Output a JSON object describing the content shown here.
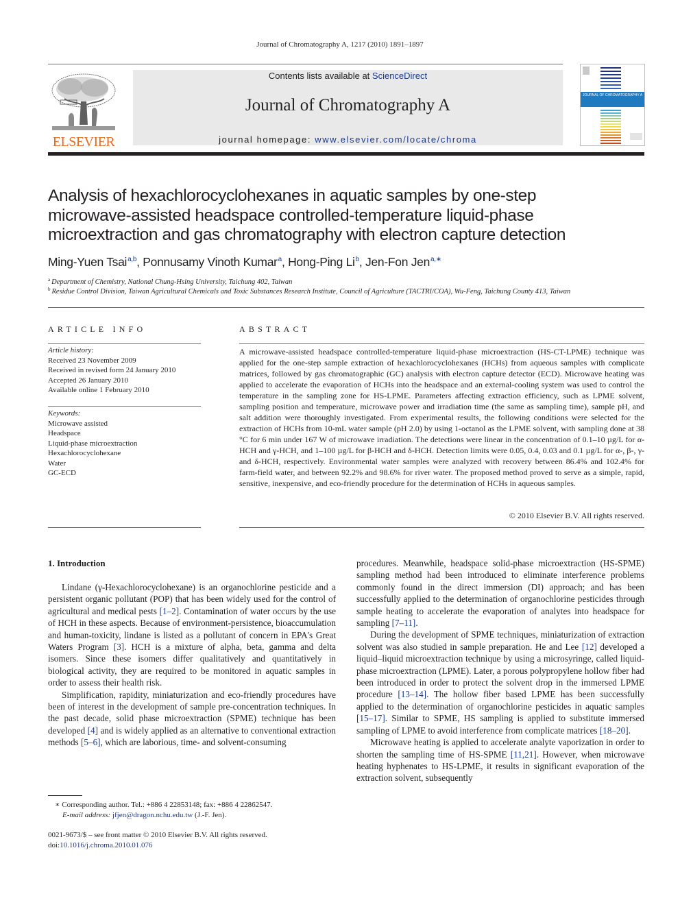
{
  "running_head": "Journal of Chromatography A, 1217 (2010) 1891–1897",
  "masthead": {
    "publisher_logo": "ELSEVIER",
    "contents_prefix": "Contents lists available at ",
    "contents_link": "ScienceDirect",
    "journal_name": "Journal of Chromatography A",
    "homepage_prefix": "journal homepage: ",
    "homepage_link": "www.elsevier.com/locate/chroma",
    "cover_title": "JOURNAL OF CHROMATOGRAPHY A",
    "colors": {
      "elsevier_orange": "#e86c1f",
      "link_blue": "#1a3a8f",
      "band_grey": "#e9e9e9",
      "cover_blue": "#1f7ac0"
    }
  },
  "article": {
    "title_lines": [
      "Analysis of hexachlorocyclohexanes in aquatic samples by one-step",
      "microwave-assisted headspace controlled-temperature liquid-phase",
      "microextraction and gas chromatography with electron capture detection"
    ],
    "authors": [
      {
        "name": "Ming-Yuen Tsai",
        "sup": "a,b",
        "sep": ", "
      },
      {
        "name": "Ponnusamy Vinoth Kumar",
        "sup": "a",
        "sep": ", "
      },
      {
        "name": "Hong-Ping Li",
        "sup": "b",
        "sep": ", "
      },
      {
        "name": "Jen-Fon Jen",
        "sup": "a,∗",
        "sep": ""
      }
    ],
    "affiliations": [
      {
        "mark": "a",
        "text": "Department of Chemistry, National Chung-Hsing University, Taichung 402, Taiwan"
      },
      {
        "mark": "b",
        "text": "Residue Control Division, Taiwan Agricultural Chemicals and Toxic Substances Research Institute, Council of Agriculture (TACTRI/COA), Wu-Feng, Taichung County 413, Taiwan"
      }
    ]
  },
  "article_info": {
    "heading": "ARTICLE INFO",
    "history_label": "Article history:",
    "history": [
      "Received 23 November 2009",
      "Received in revised form 24 January 2010",
      "Accepted 26 January 2010",
      "Available online 1 February 2010"
    ],
    "keywords_label": "Keywords:",
    "keywords": [
      "Microwave assisted",
      "Headspace",
      "Liquid-phase microextraction",
      "Hexachlorocyclohexane",
      "Water",
      "GC-ECD"
    ]
  },
  "abstract": {
    "heading": "ABSTRACT",
    "text": "A microwave-assisted headspace controlled-temperature liquid-phase microextraction (HS-CT-LPME) technique was applied for the one-step sample extraction of hexachlorocyclohexanes (HCHs) from aqueous samples with complicate matrices, followed by gas chromatographic (GC) analysis with electron capture detector (ECD). Microwave heating was applied to accelerate the evaporation of HCHs into the headspace and an external-cooling system was used to control the temperature in the sampling zone for HS-LPME. Parameters affecting extraction efficiency, such as LPME solvent, sampling position and temperature, microwave power and irradiation time (the same as sampling time), sample pH, and salt addition were thoroughly investigated. From experimental results, the following conditions were selected for the extraction of HCHs from 10-mL water sample (pH 2.0) by using 1-octanol as the LPME solvent, with sampling done at 38 °C for 6 min under 167 W of microwave irradiation. The detections were linear in the concentration of 0.1–10 µg/L for α-HCH and γ-HCH, and 1–100 µg/L for β-HCH and δ-HCH. Detection limits were 0.05, 0.4, 0.03 and 0.1 µg/L for α-, β-, γ- and δ-HCH, respectively. Environmental water samples were analyzed with recovery between 86.4% and 102.4% for farm-field water, and between 92.2% and 98.6% for river water. The proposed method proved to serve as a simple, rapid, sensitive, inexpensive, and eco-friendly procedure for the determination of HCHs in aqueous samples.",
    "copyright": "© 2010 Elsevier B.V. All rights reserved."
  },
  "introduction": {
    "heading": "1.  Introduction",
    "left_column": [
      {
        "indent": true,
        "parts": [
          {
            "t": "Lindane (γ-Hexachlorocyclohexane) is an organochlorine pesticide and a persistent organic pollutant (POP) that has been widely used for the control of agricultural and medical pests "
          },
          {
            "ref": "[1–2]"
          },
          {
            "t": ". Contamination of water occurs by the use of HCH in these aspects. Because of environment-persistence, bioaccumulation and human-toxicity, lindane is listed as a pollutant of concern in EPA's Great Waters Program "
          },
          {
            "ref": "[3]"
          },
          {
            "t": ". HCH is a mixture of alpha, beta, gamma and delta isomers. Since these isomers differ qualitatively and quantitatively in biological activity, they are required to be monitored in aquatic samples in order to assess their health risk."
          }
        ]
      },
      {
        "indent": true,
        "parts": [
          {
            "t": "Simplification, rapidity, miniaturization and eco-friendly procedures have been of interest in the development of sample pre-concentration techniques. In the past decade, solid phase microextraction (SPME) technique has been developed "
          },
          {
            "ref": "[4]"
          },
          {
            "t": " and is widely applied as an alternative to conventional extraction methods "
          },
          {
            "ref": "[5–6]"
          },
          {
            "t": ", which are laborious, time- and solvent-consuming"
          }
        ]
      }
    ],
    "right_column": [
      {
        "indent": false,
        "parts": [
          {
            "t": "procedures. Meanwhile, headspace solid-phase microextraction (HS-SPME) sampling method had been introduced to eliminate interference problems commonly found in the direct immersion (DI) approach; and has been successfully applied to the determination of organochlorine pesticides through sample heating to accelerate the evaporation of analytes into headspace for sampling "
          },
          {
            "ref": "[7–11]"
          },
          {
            "t": "."
          }
        ]
      },
      {
        "indent": true,
        "parts": [
          {
            "t": "During the development of SPME techniques, miniaturization of extraction solvent was also studied in sample preparation. He and Lee "
          },
          {
            "ref": "[12]"
          },
          {
            "t": " developed a liquid–liquid microextraction technique by using a microsyringe, called liquid-phase microextraction (LPME). Later, a porous polypropylene hollow fiber had been introduced in order to protect the solvent drop in the immersed LPME procedure "
          },
          {
            "ref": "[13–14]"
          },
          {
            "t": ". The hollow fiber based LPME has been successfully applied to the determination of organochlorine pesticides in aquatic samples "
          },
          {
            "ref": "[15–17]"
          },
          {
            "t": ". Similar to SPME, HS sampling is applied to substitute immersed sampling of LPME to avoid interference from complicate matrices "
          },
          {
            "ref": "[18–20]"
          },
          {
            "t": "."
          }
        ]
      },
      {
        "indent": true,
        "parts": [
          {
            "t": "Microwave heating is applied to accelerate analyte vaporization in order to shorten the sampling time of HS-SPME "
          },
          {
            "ref": "[11,21]"
          },
          {
            "t": ". However, when microwave heating hyphenates to HS-LPME, it results in significant evaporation of the extraction solvent, subsequently"
          }
        ]
      }
    ]
  },
  "footnotes": {
    "corresponding": "∗  Corresponding author. Tel.: +886 4 22853148; fax: +886 4 22862547.",
    "email_label": "E-mail address: ",
    "email": "jfjen@dragon.nchu.edu.tw",
    "email_suffix": " (J.-F. Jen).",
    "front_matter": "0021-9673/$ – see front matter © 2010 Elsevier B.V. All rights reserved.",
    "doi_label": "doi:",
    "doi": "10.1016/j.chroma.2010.01.076"
  }
}
